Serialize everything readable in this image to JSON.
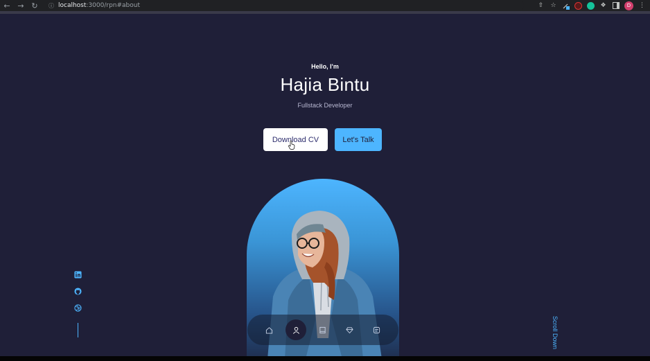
{
  "browser": {
    "url_host": "localhost",
    "url_path": ":3000/rpn#about",
    "profile_initial": "D"
  },
  "hero": {
    "greeting": "Hello, I'm",
    "name": "Hajia Bintu",
    "role": "Fullstack Developer"
  },
  "cta": {
    "download_label": "Download CV",
    "talk_label": "Let's Talk"
  },
  "nav": {
    "items": [
      "home-icon",
      "user-icon",
      "book-icon",
      "services-icon",
      "message-icon"
    ],
    "active_index": 1
  },
  "socials": [
    "linkedin-icon",
    "github-icon",
    "dribbble-icon"
  ],
  "scroll_label": "Scroll Down",
  "colors": {
    "background": "#1f1f38",
    "primary": "#4db5ff",
    "white": "#ffffff"
  }
}
